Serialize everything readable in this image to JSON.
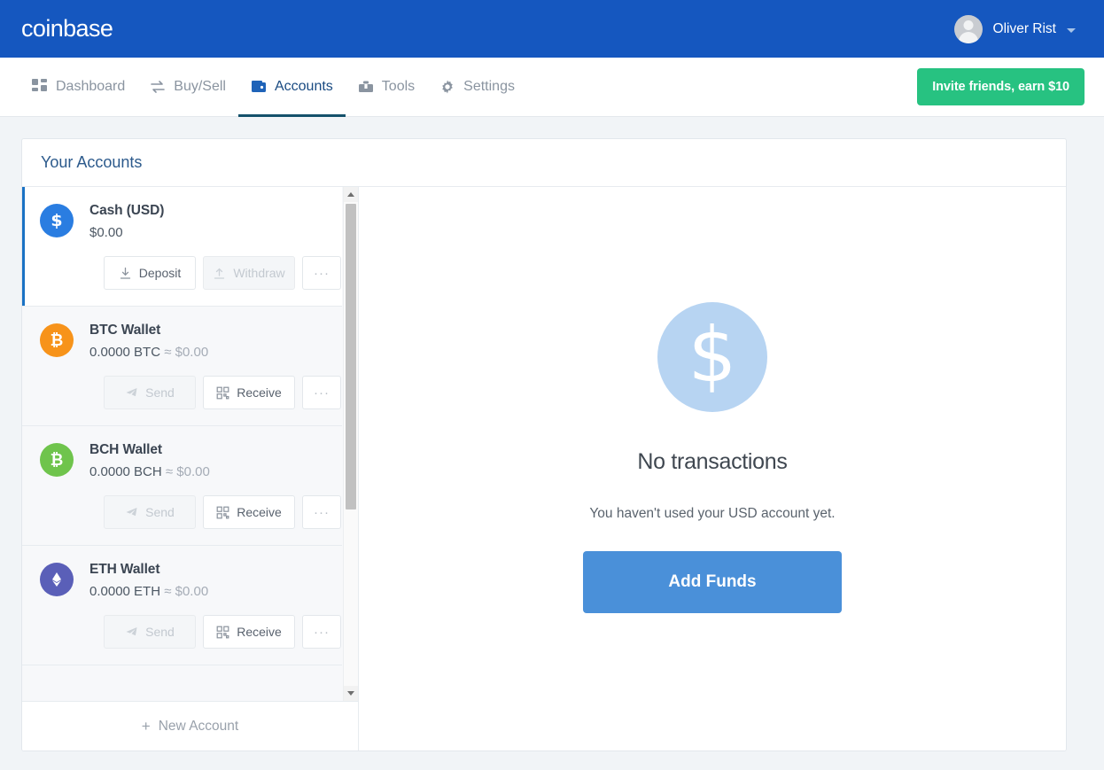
{
  "brand": {
    "logo_text": "coinbase",
    "accent_blue": "#1557bf",
    "green": "#27c281",
    "button_blue": "#4a90d9"
  },
  "topbar": {
    "user_name": "Oliver Rist"
  },
  "nav": {
    "items": [
      {
        "label": "Dashboard",
        "icon": "grid-icon",
        "active": false
      },
      {
        "label": "Buy/Sell",
        "icon": "exchange-arrows-icon",
        "active": false
      },
      {
        "label": "Accounts",
        "icon": "wallet-icon",
        "active": true
      },
      {
        "label": "Tools",
        "icon": "toolbox-icon",
        "active": false
      },
      {
        "label": "Settings",
        "icon": "gear-icon",
        "active": false
      }
    ],
    "invite_label": "Invite friends, earn $10"
  },
  "card": {
    "title": "Your Accounts",
    "new_account_label": "New Account",
    "new_account_plus": "+"
  },
  "accounts": [
    {
      "name": "Cash (USD)",
      "balance": "$0.00",
      "fiat": "",
      "approx": "",
      "coin": "usd-dollar-icon",
      "coin_color": "#2a7de1",
      "selected": true,
      "actions": [
        {
          "label": "Deposit",
          "icon": "download-arrow-icon",
          "disabled": false
        },
        {
          "label": "Withdraw",
          "icon": "upload-arrow-icon",
          "disabled": true
        },
        {
          "label": "···",
          "icon": "more-icon",
          "disabled": false
        }
      ]
    },
    {
      "name": "BTC Wallet",
      "balance": "0.0000 BTC",
      "approx": "≈",
      "fiat": "$0.00",
      "coin": "bitcoin-icon",
      "coin_color": "#f7931a",
      "selected": false,
      "actions": [
        {
          "label": "Send",
          "icon": "send-paper-plane-icon",
          "disabled": true
        },
        {
          "label": "Receive",
          "icon": "qr-code-icon",
          "disabled": false
        },
        {
          "label": "···",
          "icon": "more-icon",
          "disabled": false
        }
      ]
    },
    {
      "name": "BCH Wallet",
      "balance": "0.0000 BCH",
      "approx": "≈",
      "fiat": "$0.00",
      "coin": "bitcoin-cash-icon",
      "coin_color": "#6fc44c",
      "selected": false,
      "actions": [
        {
          "label": "Send",
          "icon": "send-paper-plane-icon",
          "disabled": true
        },
        {
          "label": "Receive",
          "icon": "qr-code-icon",
          "disabled": false
        },
        {
          "label": "···",
          "icon": "more-icon",
          "disabled": false
        }
      ]
    },
    {
      "name": "ETH Wallet",
      "balance": "0.0000 ETH",
      "approx": "≈",
      "fiat": "$0.00",
      "coin": "ethereum-icon",
      "coin_color": "#5a5fb8",
      "selected": false,
      "actions": [
        {
          "label": "Send",
          "icon": "send-paper-plane-icon",
          "disabled": true
        },
        {
          "label": "Receive",
          "icon": "qr-code-icon",
          "disabled": false
        },
        {
          "label": "···",
          "icon": "more-icon",
          "disabled": false
        }
      ]
    }
  ],
  "empty_state": {
    "icon": "dollar-circle-icon",
    "dollar_glyph": "$",
    "title": "No transactions",
    "subtitle": "You haven't used your USD account yet.",
    "cta_label": "Add Funds"
  }
}
